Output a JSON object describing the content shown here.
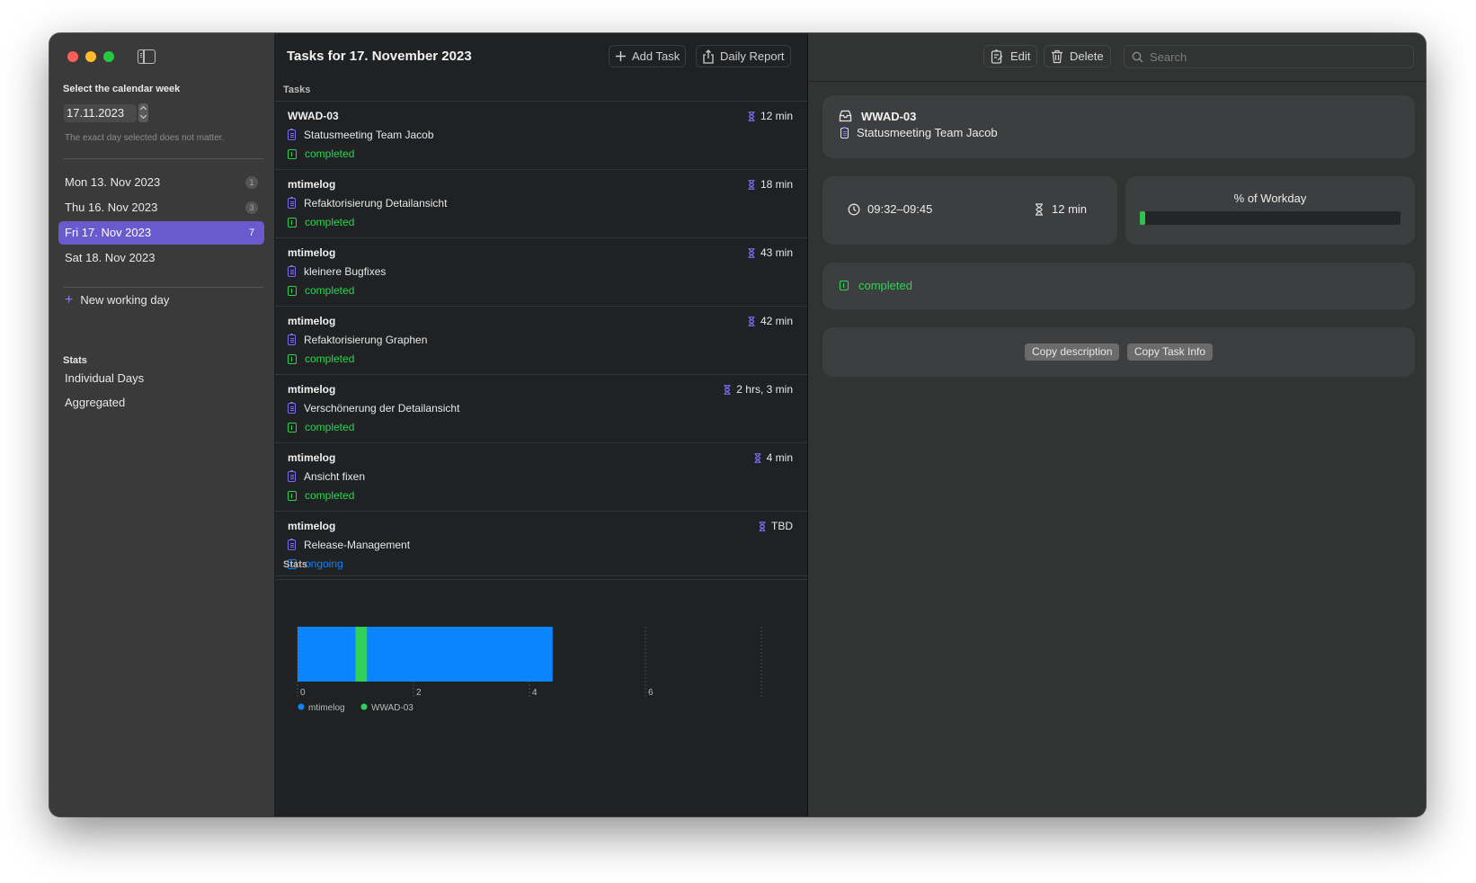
{
  "sidebar": {
    "week_title": "Select the calendar week",
    "date_value": "17.11.2023",
    "hint": "The exact day selected does not matter.",
    "days": [
      {
        "label": "Mon 13. Nov 2023",
        "count": "1"
      },
      {
        "label": "Thu 16. Nov 2023",
        "count": "3"
      },
      {
        "label": "Fri 17. Nov 2023",
        "count": "7"
      },
      {
        "label": "Sat 18. Nov 2023",
        "count": ""
      }
    ],
    "new_day_label": "New working day",
    "stats_heading": "Stats",
    "stats_items": [
      "Individual Days",
      "Aggregated"
    ]
  },
  "middle": {
    "title": "Tasks for 17. November 2023",
    "add_task_label": "Add Task",
    "daily_report_label": "Daily Report",
    "tasks_label": "Tasks",
    "stats_label": "Stats",
    "tasks": [
      {
        "project": "WWAD-03",
        "duration": "12 min",
        "description": "Statusmeeting Team Jacob",
        "status": "completed"
      },
      {
        "project": "mtimelog",
        "duration": "18 min",
        "description": "Refaktorisierung Detailansicht",
        "status": "completed"
      },
      {
        "project": "mtimelog",
        "duration": "43 min",
        "description": "kleinere Bugfixes",
        "status": "completed"
      },
      {
        "project": "mtimelog",
        "duration": "42 min",
        "description": "Refaktorisierung Graphen",
        "status": "completed"
      },
      {
        "project": "mtimelog",
        "duration": "2 hrs, 3 min",
        "description": "Verschönerung der Detailansicht",
        "status": "completed"
      },
      {
        "project": "mtimelog",
        "duration": "4 min",
        "description": "Ansicht fixen",
        "status": "completed"
      },
      {
        "project": "mtimelog",
        "duration": "TBD",
        "description": "Release-Management",
        "status": "ongoing"
      }
    ]
  },
  "chart_data": {
    "type": "bar",
    "orientation": "horizontal",
    "stacked": true,
    "segments": [
      {
        "name": "mtimelog",
        "start": 0,
        "end": 1.0
      },
      {
        "name": "WWAD-03",
        "start": 1.0,
        "end": 1.2
      },
      {
        "name": "mtimelog",
        "start": 1.2,
        "end": 4.4
      }
    ],
    "series": [
      {
        "name": "mtimelog",
        "color": "#0a84ff"
      },
      {
        "name": "WWAD-03",
        "color": "#30d158"
      }
    ],
    "x_ticks": [
      "0",
      "2",
      "4",
      "6"
    ],
    "xlim": [
      0,
      8
    ]
  },
  "detail": {
    "edit_label": "Edit",
    "delete_label": "Delete",
    "search_placeholder": "Search",
    "project": "WWAD-03",
    "description": "Statusmeeting Team Jacob",
    "time_range": "09:32–09:45",
    "duration": "12 min",
    "workday_title": "% of Workday",
    "workday_fraction": 0.02,
    "status": "completed",
    "copy_description_label": "Copy description",
    "copy_task_info_label": "Copy Task Info"
  },
  "colors": {
    "accent": "#6a5acd",
    "completed": "#30d158",
    "ongoing": "#0a84ff",
    "icon": "#7b6cf0"
  }
}
